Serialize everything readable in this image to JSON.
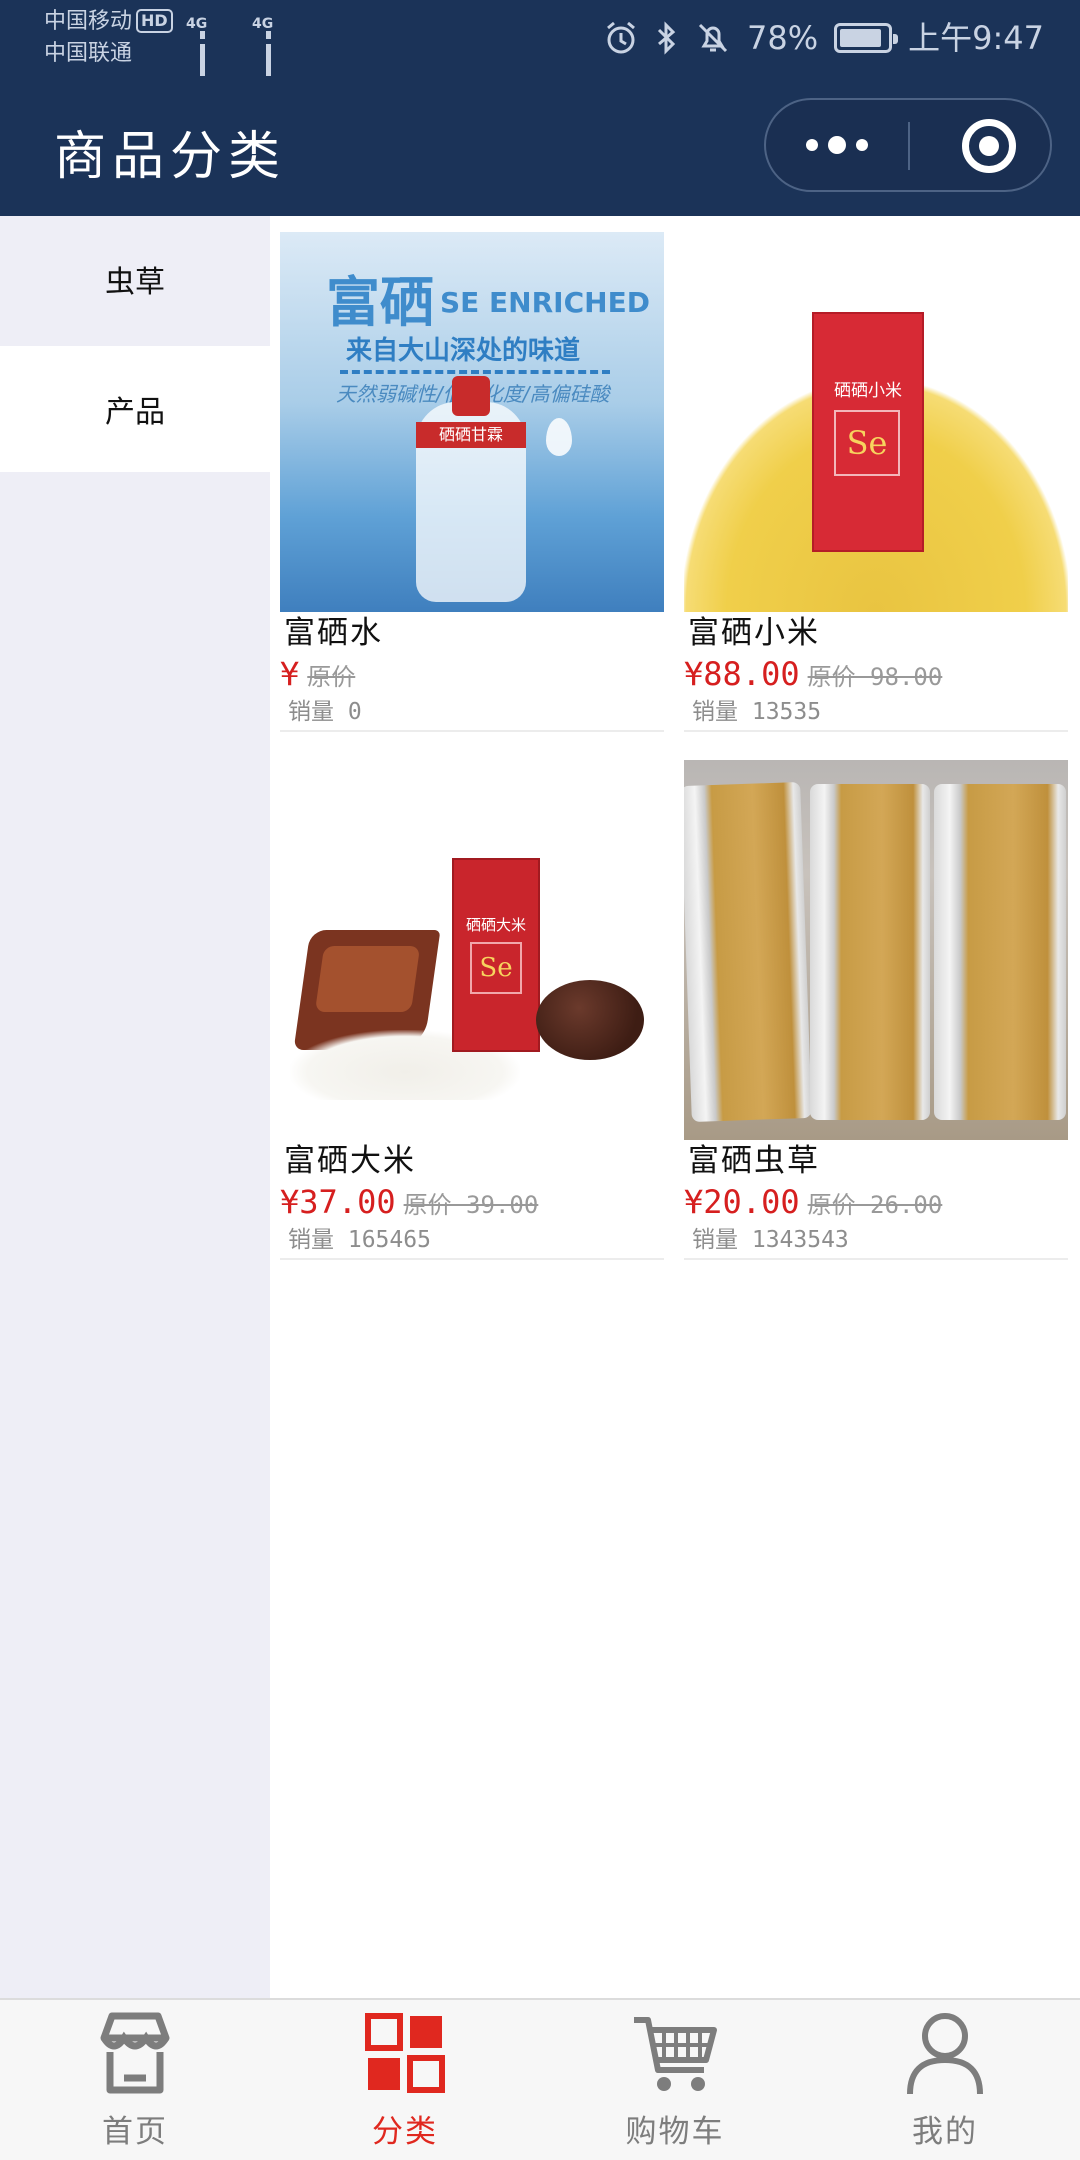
{
  "status_bar": {
    "carrier_1": "中国移动",
    "hd_badge": "HD",
    "carrier_2": "中国联通",
    "network_1": "4G",
    "network_2": "4G",
    "battery": "78%",
    "time": "上午9:47",
    "icons": [
      "alarm-icon",
      "bluetooth-icon",
      "mute-icon",
      "battery-icon"
    ]
  },
  "navbar": {
    "title": "商品分类",
    "icons": [
      "more-icon",
      "close-miniprogram-icon"
    ]
  },
  "sidebar": {
    "items": [
      {
        "label": "虫草",
        "active": false
      },
      {
        "label": "产品",
        "active": true
      }
    ]
  },
  "products": [
    {
      "name": "富硒水",
      "price": "¥",
      "original": "原价",
      "sales": "销量 0",
      "image_text": {
        "title": "富硒",
        "subtitle": "SE ENRICHED",
        "slogan": "来自大山深处的味道",
        "tagline": "天然弱碱性/低矿化度/高偏硅酸",
        "bottle_label": "硒硒甘霖"
      }
    },
    {
      "name": "富硒小米",
      "price": "¥88.00",
      "original": "原价 98.00",
      "sales": "销量 13535",
      "image_text": {
        "box_label": "硒硒小米",
        "box_mark": "Se"
      }
    },
    {
      "name": "富硒大米",
      "price": "¥37.00",
      "original": "原价 39.00",
      "sales": "销量 165465",
      "image_text": {
        "box_label": "硒硒大米",
        "box_mark": "Se"
      }
    },
    {
      "name": "富硒虫草",
      "price": "¥20.00",
      "original": "原价 26.00",
      "sales": "销量 1343543"
    }
  ],
  "tabbar": {
    "items": [
      {
        "label": "首页",
        "icon": "store-icon",
        "active": false
      },
      {
        "label": "分类",
        "icon": "category-grid-icon",
        "active": true
      },
      {
        "label": "购物车",
        "icon": "cart-icon",
        "active": false
      },
      {
        "label": "我的",
        "icon": "user-icon",
        "active": false
      }
    ]
  },
  "colors": {
    "header_bg": "#1b3358",
    "sidebar_bg": "#eeeef6",
    "price_red": "#d61f1f",
    "tab_active": "#e0281f",
    "tab_inactive": "#7d7d7d"
  }
}
